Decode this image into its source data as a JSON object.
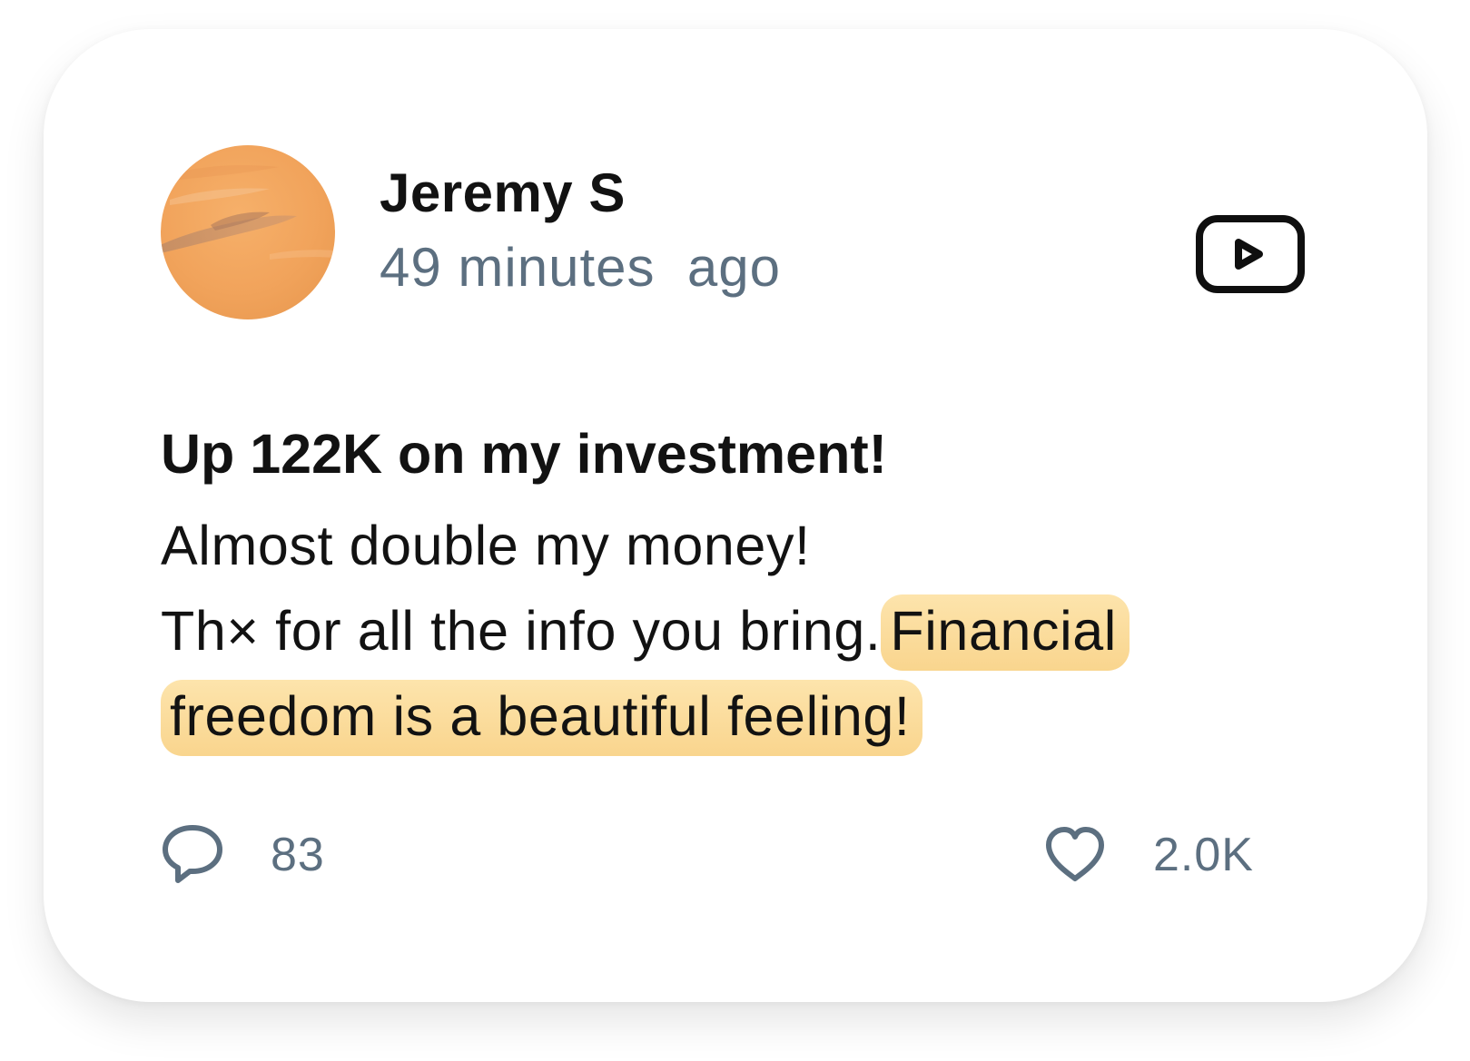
{
  "post": {
    "author": "Jeremy S",
    "time": "49 minutes  ago",
    "title": "Up 122K on my investment!",
    "body": {
      "line1": "Almost double my money!",
      "line2_plain": "Th× for all the info you bring.",
      "highlight_part1": "Financial",
      "highlight_part2": "freedom is a beautiful feeling!"
    },
    "comments_count": "83",
    "likes_count": "2.0K"
  },
  "icons": {
    "video": "video-play-icon",
    "comment": "comment-bubble-icon",
    "like": "heart-icon"
  },
  "colors": {
    "text_primary": "#121212",
    "text_secondary": "#5c6f80",
    "highlight": "#f9d58e",
    "avatar_orange": "#f2a65a"
  }
}
